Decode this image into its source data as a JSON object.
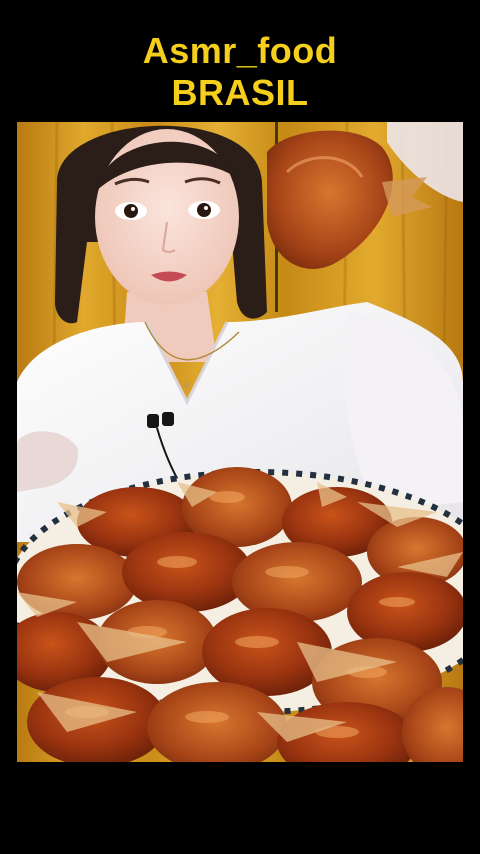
{
  "header": {
    "title_line1": "Asmr_food",
    "title_line2": "BRASIL"
  },
  "colors": {
    "background": "#000000",
    "title": "#f5cf1c",
    "curtain": "#d3961f",
    "sauce": "#8a2a0c"
  }
}
